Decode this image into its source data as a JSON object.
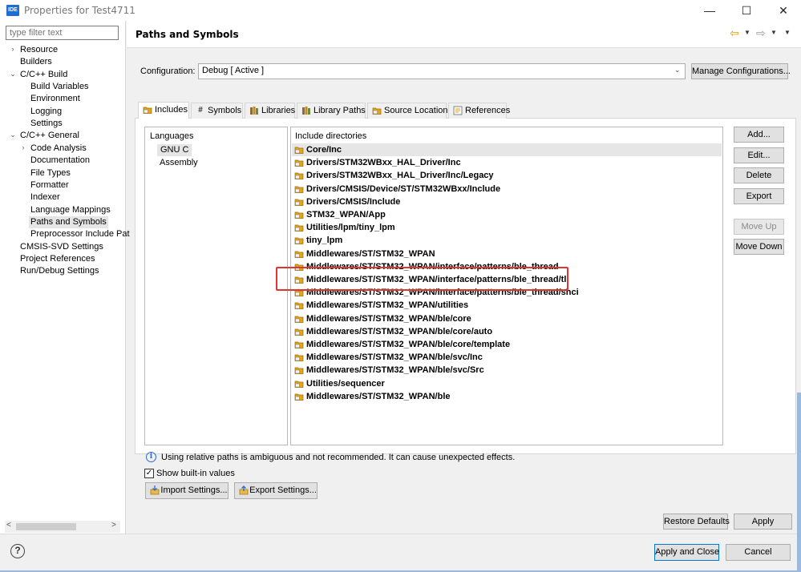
{
  "window": {
    "app_icon_text": "IDE",
    "title": "Properties for Test4711",
    "minimize": "—",
    "maximize": "☐",
    "close": "✕"
  },
  "filter": {
    "placeholder": "type filter text"
  },
  "tree": [
    {
      "label": "Resource",
      "indent": 0,
      "arrow": "›"
    },
    {
      "label": "Builders",
      "indent": 0,
      "arrow": ""
    },
    {
      "label": "C/C++ Build",
      "indent": 0,
      "arrow": "⌄"
    },
    {
      "label": "Build Variables",
      "indent": 1,
      "arrow": ""
    },
    {
      "label": "Environment",
      "indent": 1,
      "arrow": ""
    },
    {
      "label": "Logging",
      "indent": 1,
      "arrow": ""
    },
    {
      "label": "Settings",
      "indent": 1,
      "arrow": ""
    },
    {
      "label": "C/C++ General",
      "indent": 0,
      "arrow": "⌄"
    },
    {
      "label": "Code Analysis",
      "indent": 1,
      "arrow": "›"
    },
    {
      "label": "Documentation",
      "indent": 1,
      "arrow": ""
    },
    {
      "label": "File Types",
      "indent": 1,
      "arrow": ""
    },
    {
      "label": "Formatter",
      "indent": 1,
      "arrow": ""
    },
    {
      "label": "Indexer",
      "indent": 1,
      "arrow": ""
    },
    {
      "label": "Language Mappings",
      "indent": 1,
      "arrow": ""
    },
    {
      "label": "Paths and Symbols",
      "indent": 1,
      "arrow": "",
      "selected": true
    },
    {
      "label": "Preprocessor Include Pat",
      "indent": 1,
      "arrow": ""
    },
    {
      "label": "CMSIS-SVD Settings",
      "indent": 0,
      "arrow": ""
    },
    {
      "label": "Project References",
      "indent": 0,
      "arrow": ""
    },
    {
      "label": "Run/Debug Settings",
      "indent": 0,
      "arrow": ""
    }
  ],
  "header": {
    "title": "Paths and Symbols"
  },
  "configuration": {
    "label": "Configuration:",
    "value": "Debug  [ Active ]",
    "manage_label": "Manage Configurations..."
  },
  "tabs": [
    {
      "label": "Includes",
      "icon": "includes-icon",
      "active": true
    },
    {
      "label": "Symbols",
      "icon": "hash-icon"
    },
    {
      "label": "Libraries",
      "icon": "library-icon"
    },
    {
      "label": "Library Paths",
      "icon": "library-path-icon"
    },
    {
      "label": "Source Location",
      "icon": "source-folder-icon"
    },
    {
      "label": "References",
      "icon": "references-icon"
    }
  ],
  "languages": {
    "header": "Languages",
    "items": [
      "GNU C",
      "Assembly"
    ]
  },
  "includes": {
    "header": "Include directories",
    "items": [
      "Core/Inc",
      "Drivers/STM32WBxx_HAL_Driver/Inc",
      "Drivers/STM32WBxx_HAL_Driver/Inc/Legacy",
      "Drivers/CMSIS/Device/ST/STM32WBxx/Include",
      "Drivers/CMSIS/Include",
      "STM32_WPAN/App",
      "Utilities/lpm/tiny_lpm",
      "tiny_lpm",
      "Middlewares/ST/STM32_WPAN",
      "Middlewares/ST/STM32_WPAN/interface/patterns/ble_thread",
      "Middlewares/ST/STM32_WPAN/interface/patterns/ble_thread/tl",
      "Middlewares/ST/STM32_WPAN/interface/patterns/ble_thread/shci",
      "Middlewares/ST/STM32_WPAN/utilities",
      "Middlewares/ST/STM32_WPAN/ble/core",
      "Middlewares/ST/STM32_WPAN/ble/core/auto",
      "Middlewares/ST/STM32_WPAN/ble/core/template",
      "Middlewares/ST/STM32_WPAN/ble/svc/Inc",
      "Middlewares/ST/STM32_WPAN/ble/svc/Src",
      "Utilities/sequencer",
      "Middlewares/ST/STM32_WPAN/ble"
    ]
  },
  "side_buttons": [
    {
      "label": "Add...",
      "enabled": true
    },
    {
      "label": "Edit...",
      "enabled": true
    },
    {
      "label": "Delete",
      "enabled": true
    },
    {
      "label": "Export",
      "enabled": true
    },
    {
      "label": "Move Up",
      "enabled": false
    },
    {
      "label": "Move Down",
      "enabled": true
    }
  ],
  "info": {
    "text": "Using relative paths is ambiguous and not recommended. It can cause unexpected effects."
  },
  "builtin": {
    "label": "Show built-in values",
    "checked": true
  },
  "import_label": "Import Settings...",
  "export_label": "Export Settings...",
  "restore_label": "Restore Defaults",
  "apply_label": "Apply",
  "footer": {
    "help": "?",
    "apply_close_label": "Apply and Close",
    "cancel_label": "Cancel"
  },
  "colors": {
    "highlight": "#e03535",
    "folder": "#e6a515",
    "accent": "#0078d7"
  }
}
